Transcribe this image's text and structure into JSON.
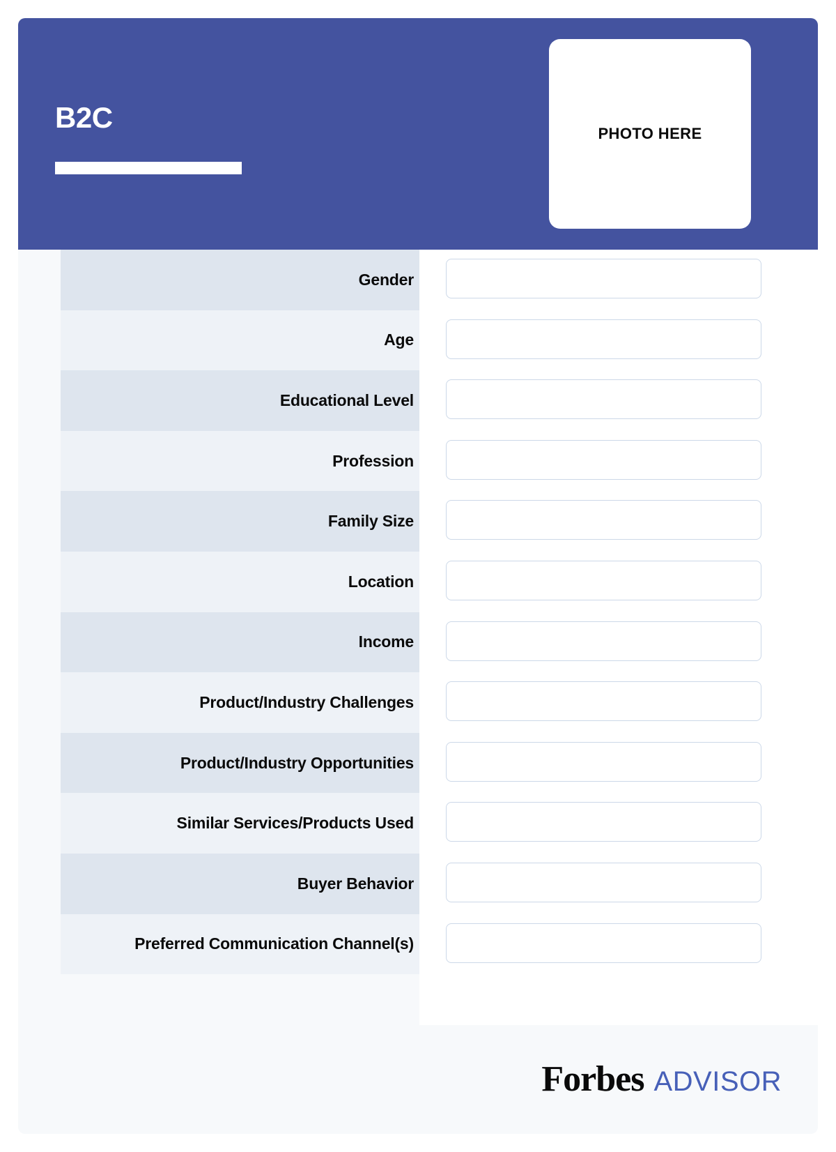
{
  "header": {
    "title": "B2C",
    "photo_placeholder": "PHOTO HERE",
    "background_color": "#44539f",
    "rule_color": "#ffffff"
  },
  "colors": {
    "accent": "#44539f",
    "row_dark": "#dee5ee",
    "row_light": "#eef2f7",
    "panel": "#f7f9fb",
    "input_border": "#ccd8e8",
    "advisor_blue": "#4760b8"
  },
  "form": {
    "rows": [
      {
        "label": "Gender",
        "value": "",
        "placeholder": ""
      },
      {
        "label": "Age",
        "value": "",
        "placeholder": ""
      },
      {
        "label": "Educational Level",
        "value": "",
        "placeholder": ""
      },
      {
        "label": "Profession",
        "value": "",
        "placeholder": ""
      },
      {
        "label": "Family Size",
        "value": "",
        "placeholder": ""
      },
      {
        "label": "Location",
        "value": "",
        "placeholder": ""
      },
      {
        "label": "Income",
        "value": "",
        "placeholder": ""
      },
      {
        "label": "Product/Industry Challenges",
        "value": "",
        "placeholder": ""
      },
      {
        "label": "Product/Industry Opportunities",
        "value": "",
        "placeholder": ""
      },
      {
        "label": "Similar Services/Products Used",
        "value": "",
        "placeholder": ""
      },
      {
        "label": "Buyer Behavior",
        "value": "",
        "placeholder": ""
      },
      {
        "label": "Preferred Communication Channel(s)",
        "value": "",
        "placeholder": ""
      }
    ]
  },
  "footer": {
    "logo_primary": "Forbes",
    "logo_secondary": "ADVISOR"
  }
}
